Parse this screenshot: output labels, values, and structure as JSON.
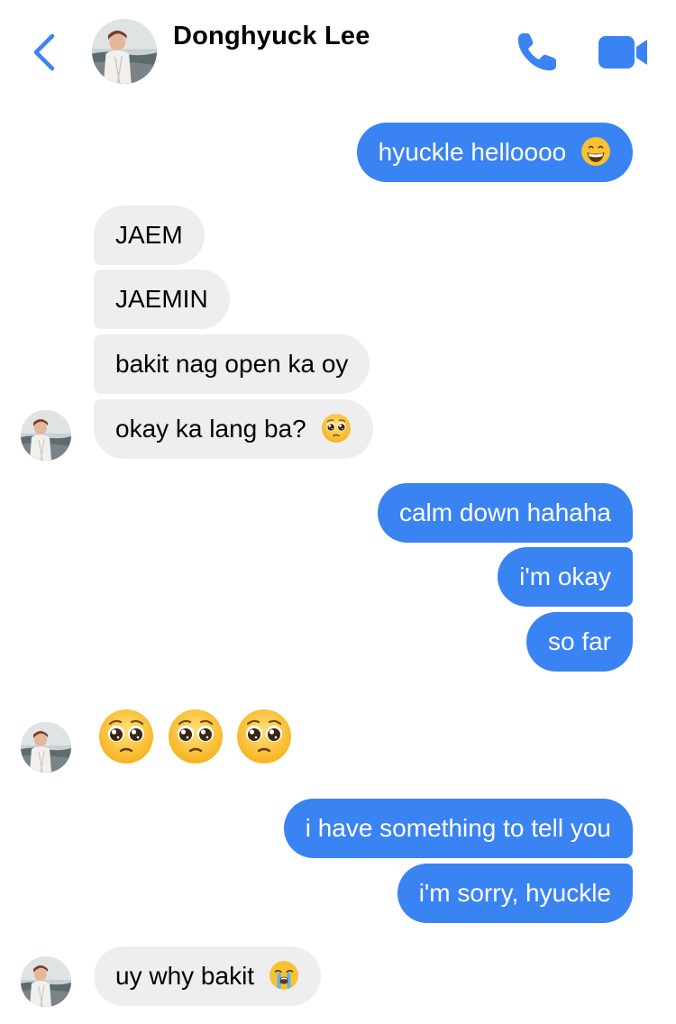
{
  "header": {
    "contact_name": "Donghyuck Lee",
    "back_icon": "chevron-left-icon",
    "call_icon": "phone-icon",
    "video_icon": "video-camera-icon",
    "accent_color": "#3a83f3"
  },
  "messages": [
    {
      "sender": "me",
      "text": "hyuckle helloooo",
      "emoji": "grinning-face"
    },
    {
      "sender": "contact",
      "text": "JAEM"
    },
    {
      "sender": "contact",
      "text": "JAEMIN"
    },
    {
      "sender": "contact",
      "text": "bakit nag open ka oy"
    },
    {
      "sender": "contact",
      "text": "okay ka lang ba?",
      "emoji": "pleading-face"
    },
    {
      "sender": "me",
      "text": "calm down hahaha"
    },
    {
      "sender": "me",
      "text": "i'm okay"
    },
    {
      "sender": "me",
      "text": "so far"
    },
    {
      "sender": "contact",
      "emoji_only": [
        "pleading-face",
        "pleading-face",
        "pleading-face"
      ]
    },
    {
      "sender": "me",
      "text": "i have something to tell you"
    },
    {
      "sender": "me",
      "text": "i'm sorry, hyuckle"
    },
    {
      "sender": "contact",
      "text": "uy why bakit",
      "emoji": "loudly-crying-face"
    }
  ],
  "colors": {
    "outgoing_bubble": "#3a83f3",
    "incoming_bubble": "#eeeef0"
  }
}
